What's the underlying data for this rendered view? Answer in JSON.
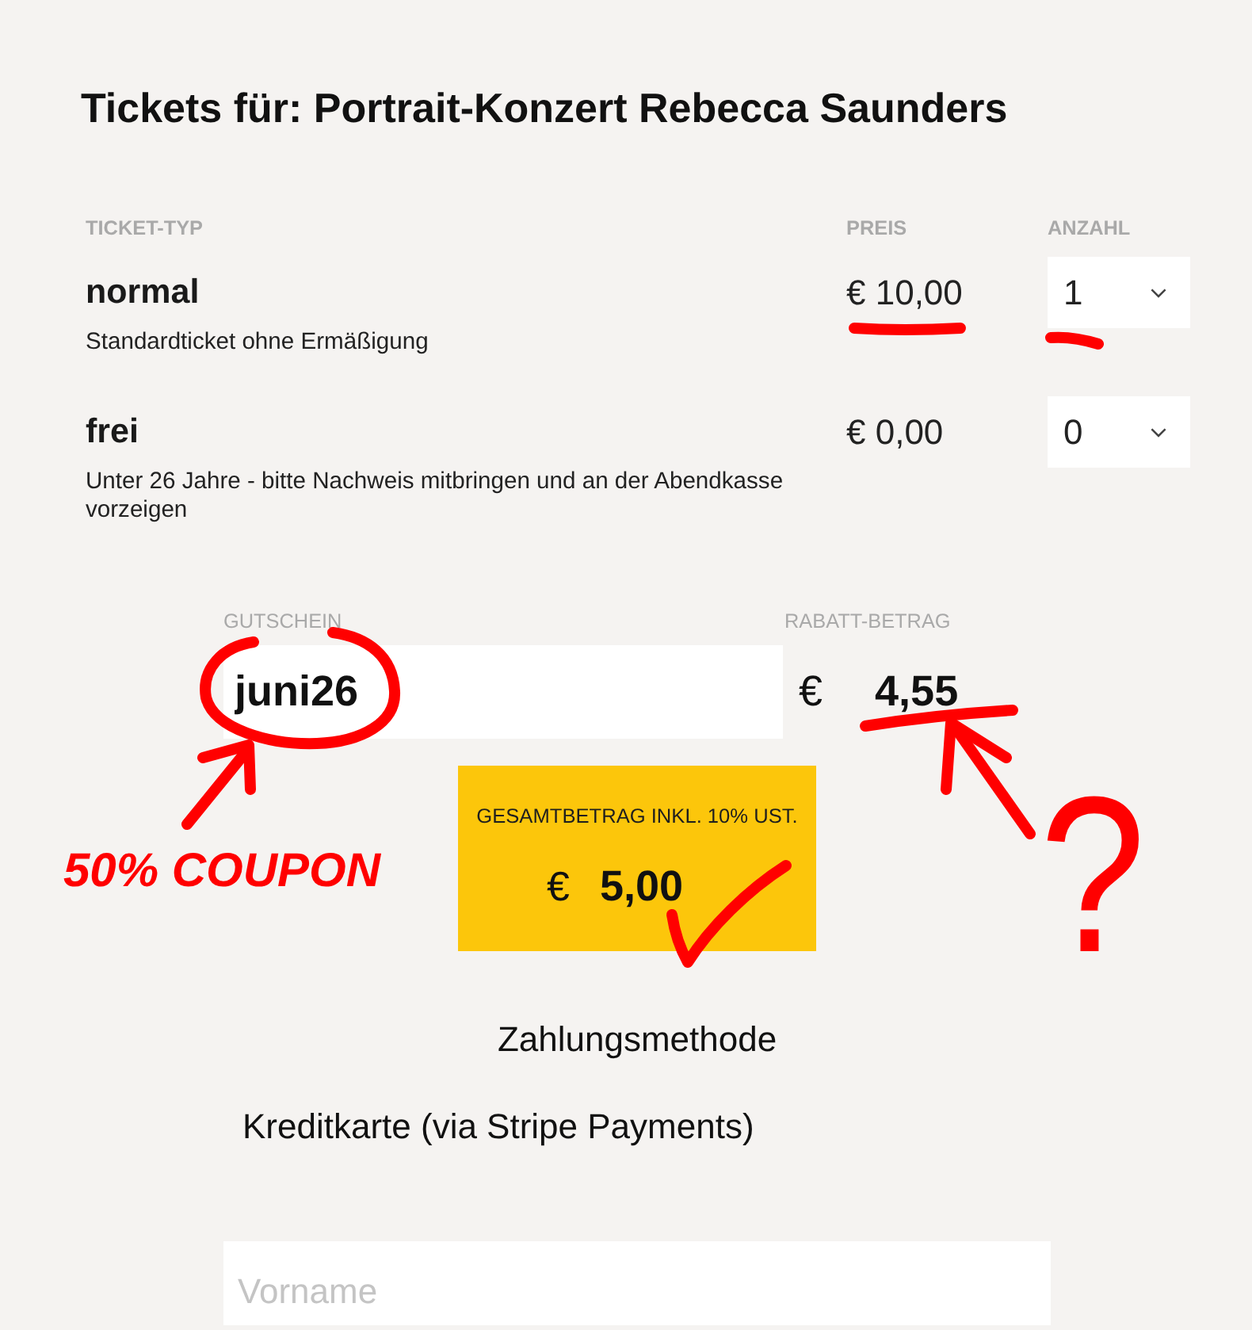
{
  "page": {
    "title": "Tickets für: Portrait-Konzert Rebecca Saunders"
  },
  "tickets": {
    "columns": [
      "TICKET-TYP",
      "PREIS",
      "ANZAHL"
    ],
    "rows": [
      {
        "name": "normal",
        "description": "Standardticket ohne Ermäßigung",
        "price": "€ 10,00",
        "quantity": "1"
      },
      {
        "name": "frei",
        "description": "Unter 26 Jahre - bitte Nachweis mitbringen und an der Abendkasse vorzeigen",
        "price": "€ 0,00",
        "quantity": "0"
      }
    ]
  },
  "coupon": {
    "label": "GUTSCHEIN",
    "code": "juni26"
  },
  "discount": {
    "label": "RABATT-BETRAG",
    "currency": "€",
    "amount": "4,55"
  },
  "total": {
    "label": "GESAMTBETRAG INKL. 10% UST.",
    "currency": "€",
    "amount": "5,00"
  },
  "payment": {
    "heading": "Zahlungsmethode",
    "method": "Kreditkarte (via Stripe Payments)"
  },
  "form": {
    "fields": [
      {
        "placeholder": "Vorname"
      }
    ]
  },
  "handwritten_notes": {
    "label": "50% COUPON",
    "symbol": "?"
  }
}
